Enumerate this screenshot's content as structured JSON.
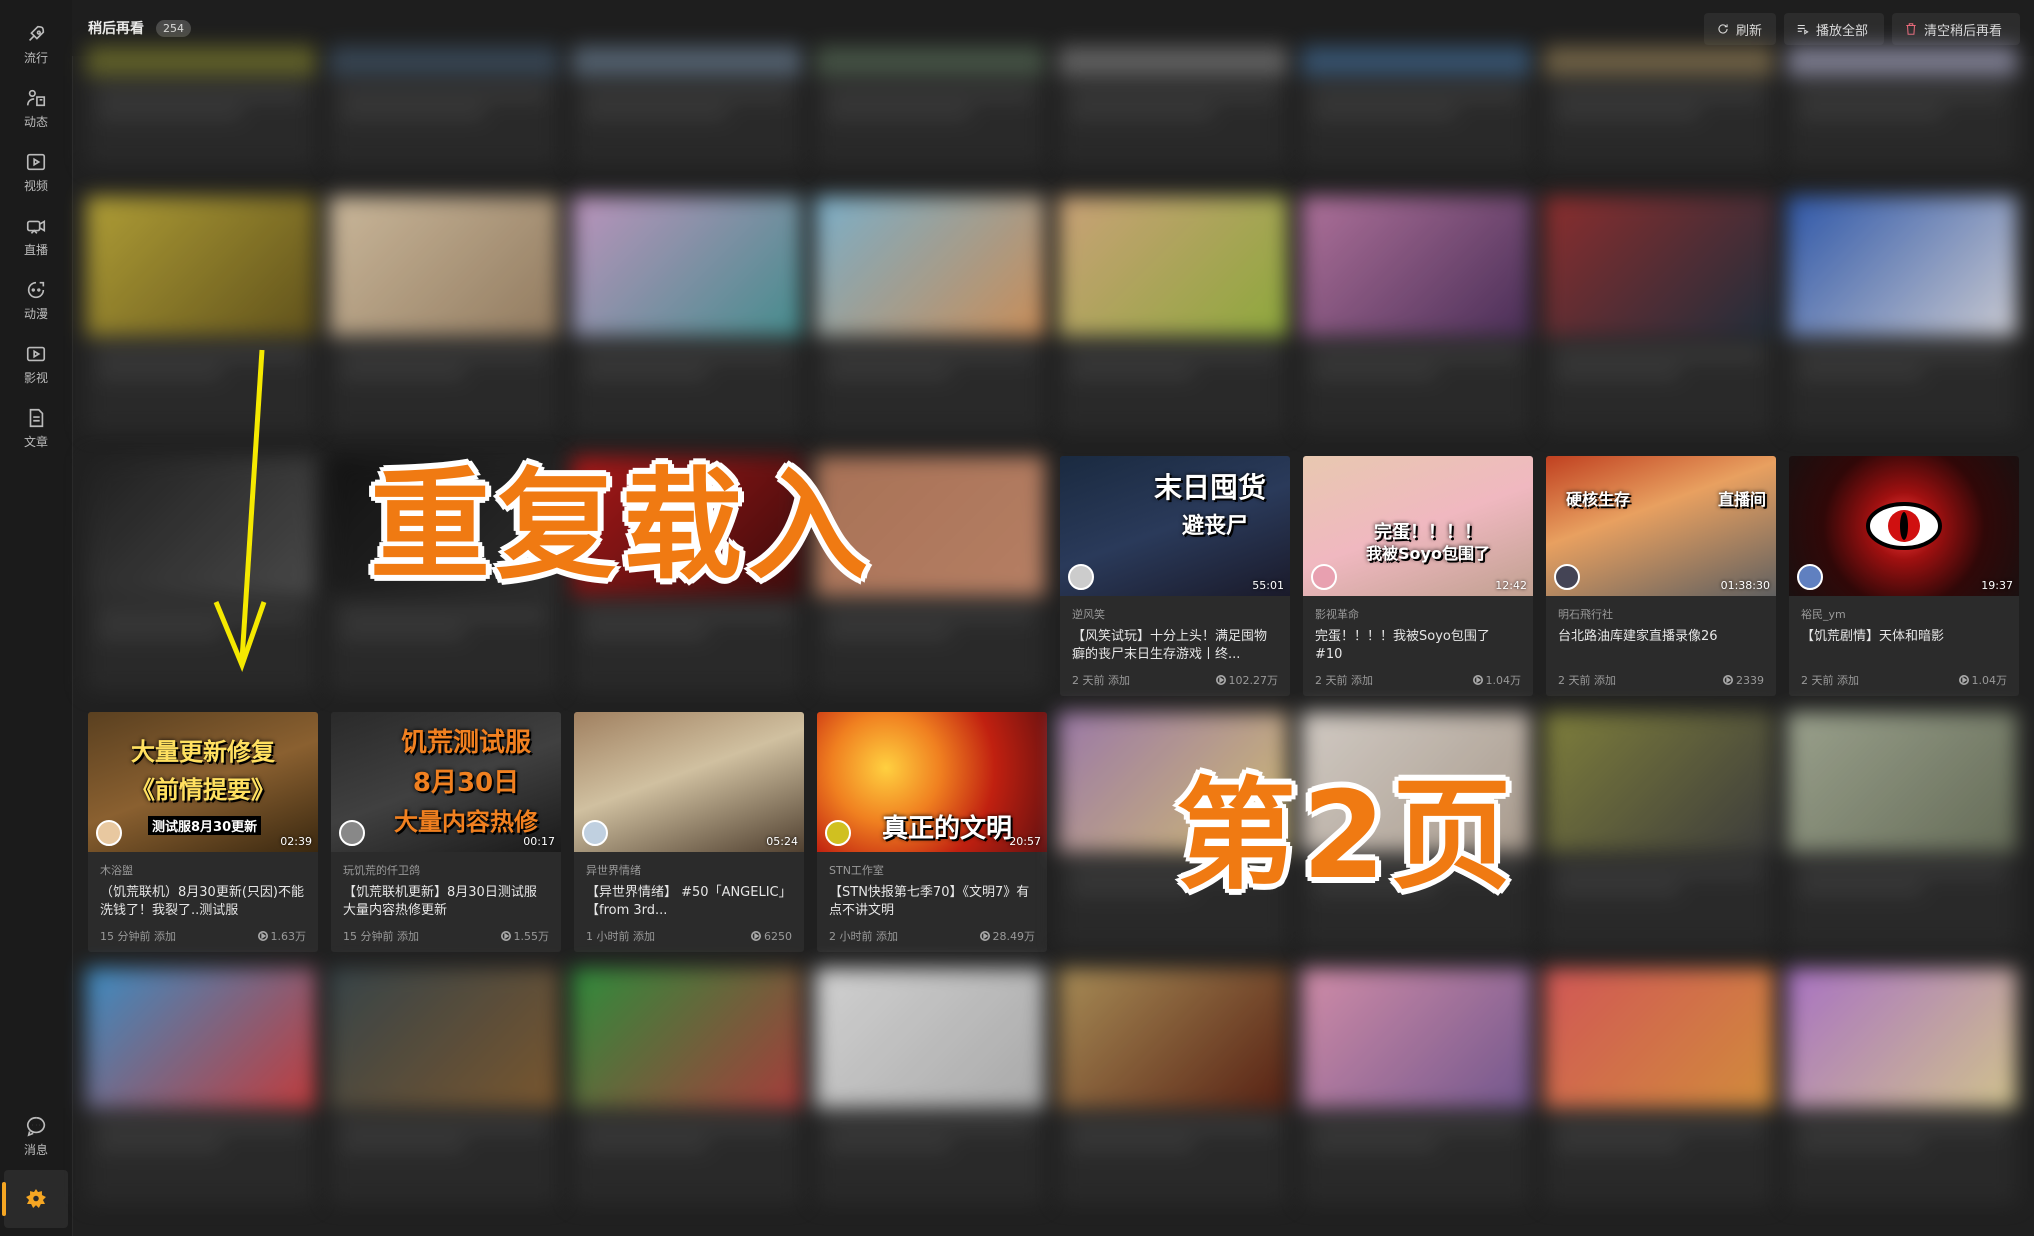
{
  "header": {
    "title": "稍后再看",
    "count": "254",
    "buttons": {
      "refresh": "刷新",
      "play_all": "播放全部",
      "clear": "清空稍后再看"
    }
  },
  "sidebar": {
    "items": [
      {
        "label": "流行",
        "icon": "rocket-icon"
      },
      {
        "label": "动态",
        "icon": "dynamic-icon"
      },
      {
        "label": "视频",
        "icon": "video-play-icon"
      },
      {
        "label": "直播",
        "icon": "live-camera-icon"
      },
      {
        "label": "动漫",
        "icon": "anime-icon"
      },
      {
        "label": "影视",
        "icon": "film-icon"
      },
      {
        "label": "文章",
        "icon": "document-icon"
      }
    ],
    "bottom": {
      "label": "消息",
      "icon": "message-icon"
    },
    "settings_icon": "gear-icon"
  },
  "overlays": {
    "reload_text": "重复载入",
    "page2_text": "第2页",
    "arrow_color": "#f5e900"
  },
  "cards_row3": [
    {
      "uploader": "逆风笑",
      "title": "【风笑试玩】十分上头！满足囤物癖的丧尸末日生存游戏丨终...",
      "added": "2 天前 添加",
      "views": "102.27万",
      "duration": "55:01",
      "thumb_text": "末日囤货",
      "thumb_sub": "避丧尸"
    },
    {
      "uploader": "影视革命",
      "title": "完蛋！！！！我被Soyo包围了 #10",
      "added": "2 天前 添加",
      "views": "1.04万",
      "duration": "12:42",
      "thumb_text": "完蛋！！！！",
      "thumb_sub": "我被Soyo包围了"
    },
    {
      "uploader": "明石飛行社",
      "title": "台北路油库建家直播录像26",
      "added": "2 天前 添加",
      "views": "2339",
      "duration": "01:38:30",
      "thumb_text": "硬核生存",
      "thumb_sub": "直播间"
    },
    {
      "uploader": "裕民_ym",
      "title": "【饥荒剧情】天体和暗影",
      "added": "2 天前 添加",
      "views": "1.04万",
      "duration": "19:37"
    }
  ],
  "cards_row4": [
    {
      "uploader": "木浴盥",
      "title": "（饥荒联机）8月30更新(只因)不能洗钱了！我裂了..测试服",
      "added": "15 分钟前 添加",
      "views": "1.63万",
      "duration": "02:39",
      "thumb_text": "大量更新修复",
      "thumb_sub": "《前情提要》",
      "thumb_badge": "测试服8月30更新"
    },
    {
      "uploader": "玩饥荒的仟卫鸽",
      "title": "【饥荒联机更新】8月30日测试服大量内容热修更新",
      "added": "15 分钟前 添加",
      "views": "1.55万",
      "duration": "00:17",
      "thumb_text": "饥荒测试服",
      "thumb_sub": "8月30日",
      "thumb_badge": "大量内容热修"
    },
    {
      "uploader": "异世界情绪",
      "title": "【异世界情绪】 #50「ANGELIC」【from 3rd...",
      "added": "1 小时前 添加",
      "views": "6250",
      "duration": "05:24"
    },
    {
      "uploader": "STN工作室",
      "title": "【STN快报第七季70】《文明7》有点不讲文明",
      "added": "2 小时前 添加",
      "views": "28.49万",
      "duration": "20:57",
      "thumb_text": "真正的文明"
    }
  ]
}
